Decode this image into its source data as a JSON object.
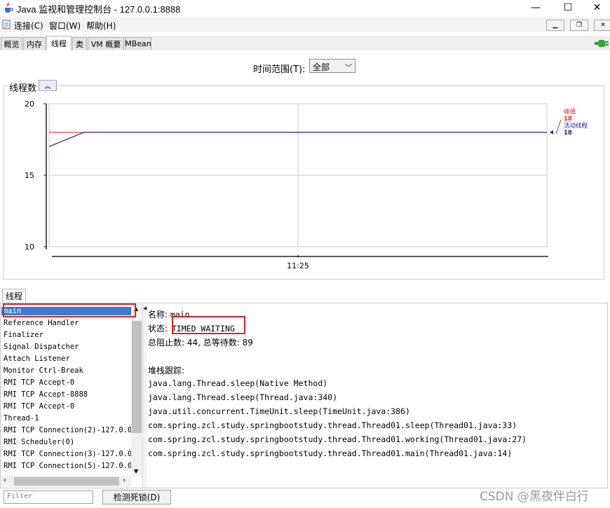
{
  "window": {
    "title": "Java 监视和管理控制台 - 127.0.0.1:8888",
    "minimize": "—",
    "maximize": "☐",
    "close": "✕"
  },
  "menu": {
    "items": [
      "连接(C)",
      "窗口(W)",
      "帮助(H)"
    ],
    "mdi_minimize": "▁",
    "mdi_restore": "❐",
    "mdi_close": "✕"
  },
  "tabs": [
    {
      "label": "概览",
      "active": false
    },
    {
      "label": "内存",
      "active": false
    },
    {
      "label": "线程",
      "active": true
    },
    {
      "label": "类",
      "active": false
    },
    {
      "label": "VM 概要",
      "active": false
    },
    {
      "label": "MBean",
      "active": false
    }
  ],
  "time_range": {
    "label": "时间范围(T):",
    "value": "全部"
  },
  "chart_section": {
    "title": "线程数",
    "collapse_icon": "chevron-up-icon"
  },
  "chart_data": {
    "type": "line",
    "y_ticks": [
      "20",
      "15",
      "10"
    ],
    "ylim": [
      10,
      20
    ],
    "x_ticks": [
      "11:25"
    ],
    "grid": true,
    "legend_position": "right",
    "series": [
      {
        "name": "峰值",
        "value_label": "18",
        "color": "#ff2020",
        "points": [
          [
            0,
            18
          ],
          [
            1,
            18
          ]
        ]
      },
      {
        "name": "活动线程",
        "value_label": "18",
        "color": "#2020a0",
        "points": [
          [
            0,
            17
          ],
          [
            0.07,
            18
          ],
          [
            1,
            18
          ]
        ]
      }
    ]
  },
  "threads_panel": {
    "tab_label": "线程",
    "threads": [
      "main",
      "Reference Handler",
      "Finalizer",
      "Signal Dispatcher",
      "Attach Listener",
      "Monitor Ctrl-Break",
      "RMI TCP Accept-0",
      "RMI TCP Accept-8888",
      "RMI TCP Accept-0",
      "Thread-1",
      "RMI TCP Connection(2)-127.0.0.",
      "RMI Scheduler(0)",
      "RMI TCP Connection(3)-127.0.0.",
      "RMI TCP Connection(5)-127.0.0."
    ],
    "selected_index": 0
  },
  "detail": {
    "name_label": "名称:",
    "name_value": "main",
    "state_label": "状态:",
    "state_value": "TIMED_WAITING",
    "totals": "总阻止数: 44, 总等待数: 89",
    "stack_label": "堆栈跟踪:",
    "stack": [
      "java.lang.Thread.sleep(Native Method)",
      "java.lang.Thread.sleep(Thread.java:340)",
      "java.util.concurrent.TimeUnit.sleep(TimeUnit.java:386)",
      "com.spring.zcl.study.springbootstudy.thread.Thread01.sleep(Thread01.java:33)",
      "com.spring.zcl.study.springbootstudy.thread.Thread01.working(Thread01.java:27)",
      "com.spring.zcl.study.springbootstudy.thread.Thread01.main(Thread01.java:14)"
    ]
  },
  "filter": {
    "placeholder": "Filter"
  },
  "deadlock_button": "检测死锁(D)",
  "watermark": "CSDN @黑夜伴白行"
}
